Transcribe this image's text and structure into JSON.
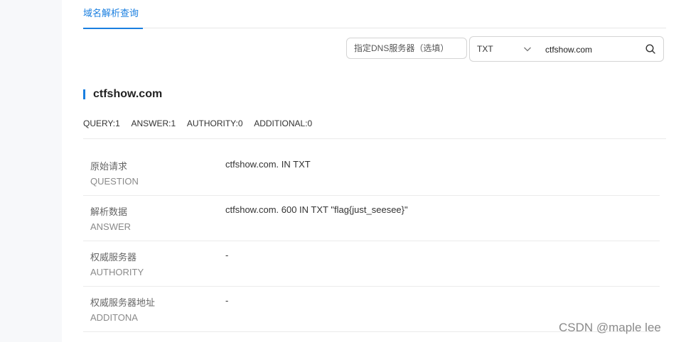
{
  "tabs": [
    {
      "label": "域名解析查询",
      "active": true
    }
  ],
  "search": {
    "dns_server_placeholder": "指定DNS服务器（选填）",
    "record_type": "TXT",
    "domain_value": "ctfshow.com"
  },
  "result": {
    "title": "ctfshow.com",
    "counts": [
      {
        "label": "QUERY",
        "value": "1",
        "text": "QUERY:1"
      },
      {
        "label": "ANSWER",
        "value": "1",
        "text": "ANSWER:1"
      },
      {
        "label": "AUTHORITY",
        "value": "0",
        "text": "AUTHORITY:0"
      },
      {
        "label": "ADDITIONAL",
        "value": "0",
        "text": "ADDITIONAL:0"
      }
    ],
    "rows": [
      {
        "cn": "原始请求",
        "en": "QUESTION",
        "value": "ctfshow.com. IN TXT"
      },
      {
        "cn": "解析数据",
        "en": "ANSWER",
        "value": "ctfshow.com. 600 IN TXT \"flag{just_seesee}\""
      },
      {
        "cn": "权威服务器",
        "en": "AUTHORITY",
        "value": "-"
      },
      {
        "cn": "权威服务器地址",
        "en": "ADDITONA",
        "value": "-"
      }
    ]
  },
  "watermark": "CSDN @maple lee",
  "colors": {
    "accent": "#1a7fe0",
    "rail": "#f7f8fa",
    "divider": "#ebebeb"
  },
  "icons": {
    "type_dropdown": "chevron-down-icon",
    "search": "search-icon"
  }
}
